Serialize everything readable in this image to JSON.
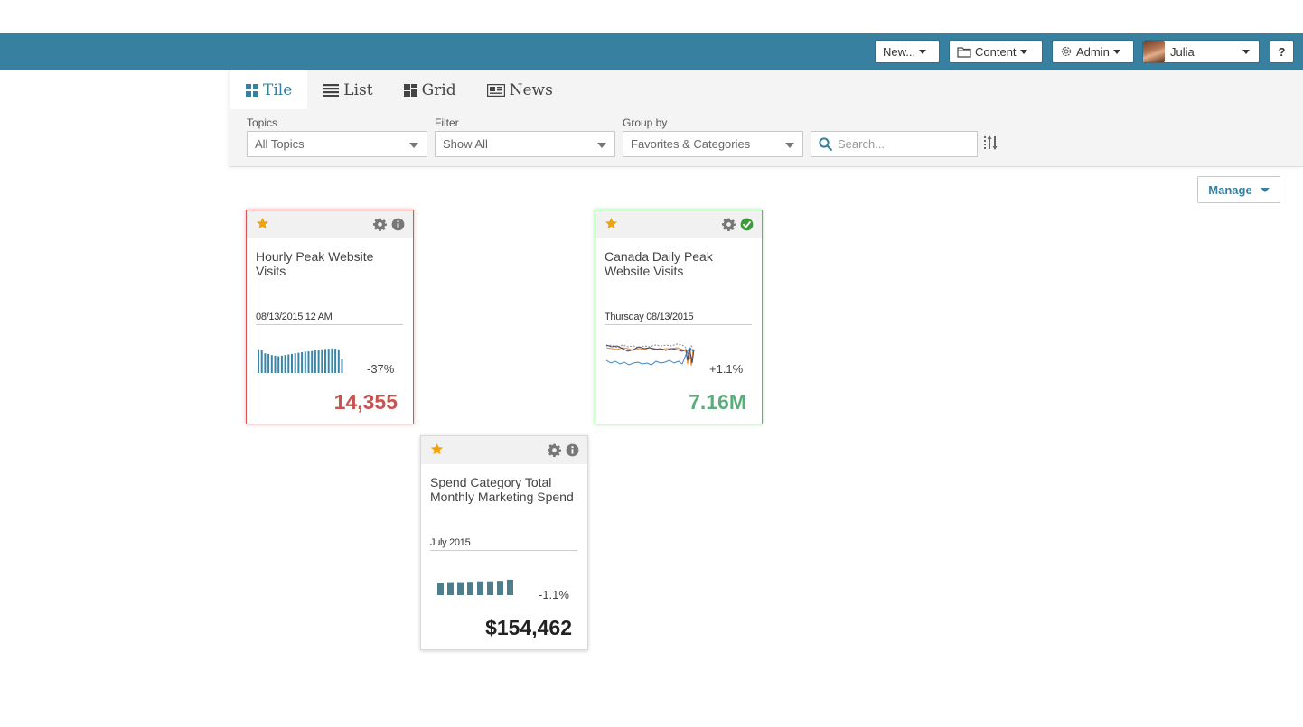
{
  "topbar": {
    "new_label": "New...",
    "content_label": "Content",
    "admin_label": "Admin",
    "user_name": "Julia",
    "help_label": "?"
  },
  "tabs": [
    {
      "label": "Tile",
      "icon": "tile-icon",
      "active": true
    },
    {
      "label": "List",
      "icon": "list-icon",
      "active": false
    },
    {
      "label": "Grid",
      "icon": "grid-icon",
      "active": false
    },
    {
      "label": "News",
      "icon": "news-icon",
      "active": false
    }
  ],
  "filters": {
    "topics": {
      "label": "Topics",
      "value": "All Topics"
    },
    "filter": {
      "label": "Filter",
      "value": "Show All"
    },
    "group_by": {
      "label": "Group by",
      "value": "Favorites & Categories"
    },
    "search": {
      "placeholder": "Search..."
    }
  },
  "manage_label": "Manage",
  "colors": {
    "accent": "#37809f",
    "negative": "#d9534f",
    "positive": "#5cb85c",
    "star": "#f0a30a",
    "bar_blue": "#3a86a8",
    "bar_slate": "#4e7d8c"
  },
  "tiles": [
    {
      "title": "Hourly Peak Website Visits",
      "date": "08/13/2015 12 AM",
      "change": "-37%",
      "value": "14,355",
      "status": "negative",
      "status_icon": "info-icon",
      "spark_values": [
        0.82,
        0.8,
        0.68,
        0.66,
        0.62,
        0.6,
        0.58,
        0.6,
        0.62,
        0.64,
        0.66,
        0.68,
        0.7,
        0.72,
        0.74,
        0.75,
        0.76,
        0.78,
        0.8,
        0.82,
        0.83,
        0.84,
        0.85,
        0.84,
        0.82,
        0.5
      ]
    },
    {
      "title": "Canada Daily Peak Website Visits",
      "date": "Thursday 08/13/2015",
      "change": "+1.1%",
      "value": "7.16M",
      "status": "positive",
      "status_icon": "check-circle-icon"
    },
    {
      "title": "Spend Category Total Monthly Marketing Spend",
      "date": "July 2015",
      "change": "-1.1%",
      "value": "$154,462",
      "status": "neutral",
      "status_icon": "info-icon",
      "spark_values": [
        0.75,
        0.8,
        0.8,
        0.82,
        0.85,
        0.85,
        0.88,
        0.95
      ]
    }
  ]
}
